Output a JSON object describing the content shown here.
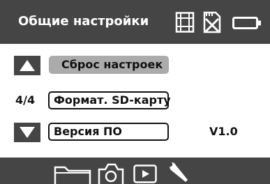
{
  "header": {
    "title": "Общие настройки",
    "status_icons": [
      "film-strip-icon",
      "card-crossed-icon",
      "battery-icon"
    ]
  },
  "menu": {
    "counter": "4/4",
    "items": [
      {
        "label": "Сброс настроек",
        "selected": true,
        "value": ""
      },
      {
        "label": "Формат. SD-карту",
        "selected": false,
        "value": ""
      },
      {
        "label": "Версия ПО",
        "selected": false,
        "value": "V1.0"
      }
    ],
    "nav": [
      "arrow-up-icon",
      "arrow-down-icon"
    ]
  },
  "footer": {
    "tabs": [
      "folder-icon",
      "camera-icon",
      "play-icon",
      "wrench-icon"
    ],
    "active_tab": "wrench-icon"
  },
  "colors": {
    "bar": "#454545",
    "selected": "#ababab",
    "text": "#111111",
    "icon": "#ffffff"
  }
}
